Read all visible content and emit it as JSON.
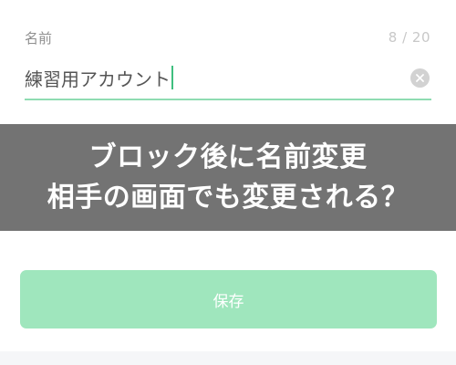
{
  "field": {
    "label": "名前",
    "counter": "8 / 20",
    "value": "練習用アカウント",
    "clear_icon": "clear-circle-x-icon"
  },
  "overlay": {
    "line1": "ブロック後に名前変更",
    "line2": "相手の画面でも変更される？"
  },
  "actions": {
    "save_label": "保存"
  },
  "colors": {
    "accent_underline": "#8fdcb2",
    "caret": "#3fbf7f",
    "save_button": "#9fe6bd",
    "overlay_bg": "#737373"
  }
}
